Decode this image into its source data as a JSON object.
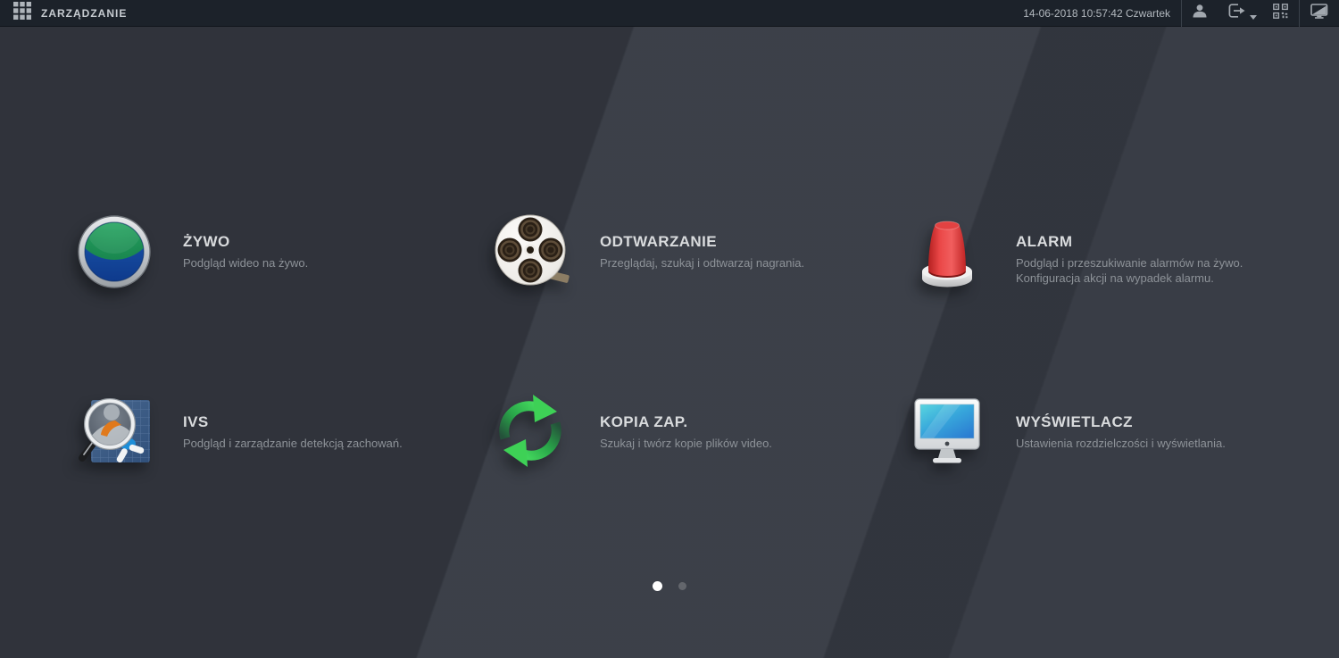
{
  "topbar": {
    "title": "ZARZĄDZANIE",
    "datetime": "14-06-2018 10:57:42 Czwartek",
    "icons": [
      "grid-menu",
      "user",
      "logout",
      "qr-code",
      "display-toggle"
    ]
  },
  "menu": {
    "items": [
      {
        "id": "live",
        "title": "ŻYWO",
        "desc": [
          "Podgląd wideo na żywo."
        ]
      },
      {
        "id": "playback",
        "title": "ODTWARZANIE",
        "desc": [
          "Przeglądaj, szukaj i odtwarzaj nagrania."
        ]
      },
      {
        "id": "alarm",
        "title": "ALARM",
        "desc": [
          "Podgląd i przeszukiwanie alarmów na żywo.",
          "Konfiguracja akcji na wypadek alarmu."
        ]
      },
      {
        "id": "ivs",
        "title": "IVS",
        "desc": [
          "Podgląd i zarządzanie detekcją zachowań."
        ]
      },
      {
        "id": "backup",
        "title": "KOPIA ZAP.",
        "desc": [
          "Szukaj i twórz kopie plików video."
        ]
      },
      {
        "id": "display",
        "title": "WYŚWIETLACZ",
        "desc": [
          "Ustawienia rozdzielczości i wyświetlania."
        ]
      }
    ]
  },
  "pagination": {
    "pages": 2,
    "active": 0
  },
  "colors": {
    "topbar_bg": "#1c222a",
    "main_bg": "#353942",
    "title_text": "#d9dbdd",
    "desc_text": "#8d9298",
    "live_green": "#2aa35c",
    "live_blue": "#1348a0",
    "alarm_red": "#e84040",
    "backup_green": "#3fd457",
    "screen_cyan": "#4fd2da",
    "screen_blue": "#2b7cd2"
  }
}
